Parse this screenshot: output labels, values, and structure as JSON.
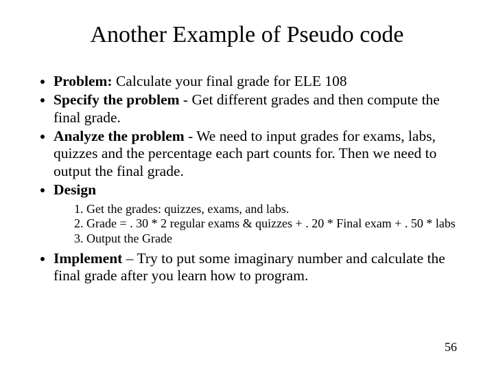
{
  "title": "Another Example of Pseudo code",
  "bullets": {
    "problem_label": "Problem:",
    "problem_text": " Calculate your final grade for ELE 108",
    "specify_label": "Specify the problem",
    "specify_text": " - Get different grades and then compute the final grade.",
    "analyze_label": "Analyze the problem",
    "analyze_text": " - We need to input grades for exams, labs, quizzes and the percentage each part counts for.  Then we need to output the final grade.",
    "design_label": "Design",
    "design_steps": [
      "Get the grades: quizzes, exams, and labs.",
      "Grade = . 30 * 2 regular exams & quizzes  +  . 20 * Final exam + . 50 * labs",
      "Output the Grade"
    ],
    "implement_label": "Implement",
    "implement_text": " – Try to put some imaginary number and calculate the final grade after you learn how to program."
  },
  "page_number": "56"
}
